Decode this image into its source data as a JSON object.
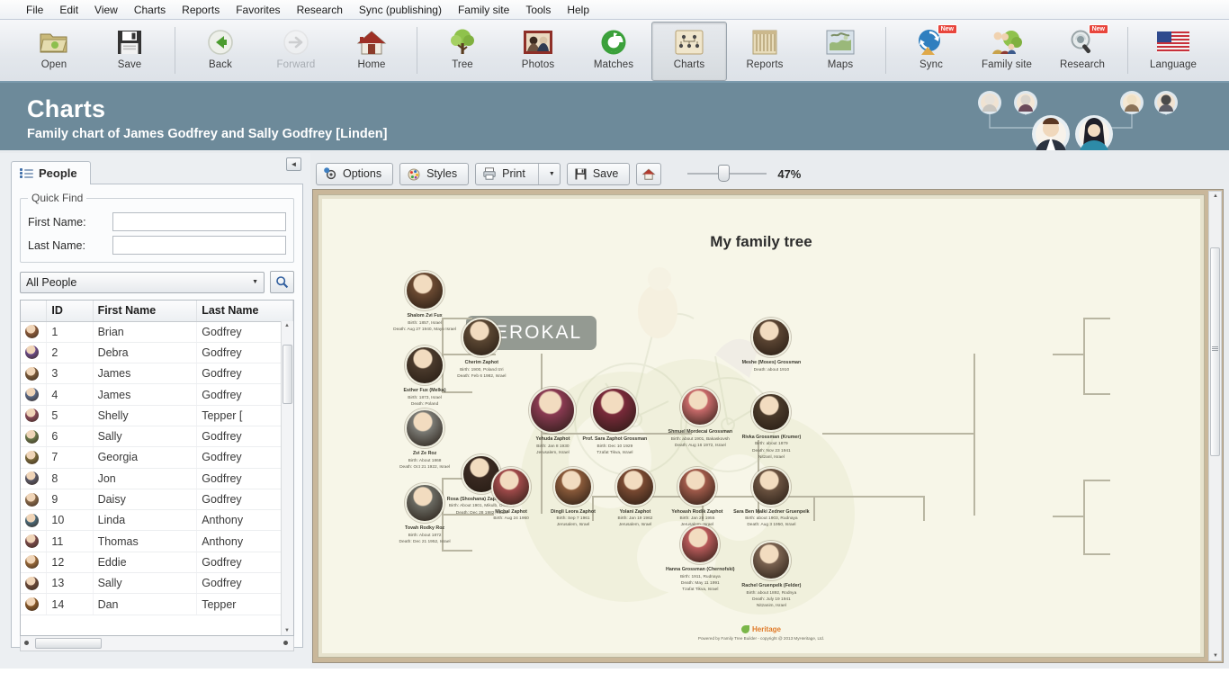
{
  "menu": {
    "items": [
      "File",
      "Edit",
      "View",
      "Charts",
      "Reports",
      "Favorites",
      "Research",
      "Sync (publishing)",
      "Family site",
      "Tools",
      "Help"
    ]
  },
  "toolbar": {
    "groups": [
      {
        "buttons": [
          {
            "label": "Open",
            "icon": "open-folder-icon",
            "state": "normal"
          },
          {
            "label": "Save",
            "icon": "floppy-disk-icon",
            "state": "normal"
          }
        ]
      },
      {
        "buttons": [
          {
            "label": "Back",
            "icon": "back-arrow-icon",
            "state": "normal"
          },
          {
            "label": "Forward",
            "icon": "forward-arrow-icon",
            "state": "disabled"
          },
          {
            "label": "Home",
            "icon": "house-icon",
            "state": "normal"
          }
        ]
      },
      {
        "buttons": [
          {
            "label": "Tree",
            "icon": "tree-icon",
            "state": "normal"
          },
          {
            "label": "Photos",
            "icon": "photos-icon",
            "state": "normal"
          },
          {
            "label": "Matches",
            "icon": "matches-refresh-icon",
            "state": "normal"
          },
          {
            "label": "Charts",
            "icon": "charts-icon",
            "state": "pressed"
          },
          {
            "label": "Reports",
            "icon": "reports-icon",
            "state": "normal"
          },
          {
            "label": "Maps",
            "icon": "maps-globe-icon",
            "state": "normal"
          }
        ]
      },
      {
        "buttons": [
          {
            "label": "Sync",
            "icon": "sync-icon",
            "state": "normal",
            "badge": "New"
          },
          {
            "label": "Family site",
            "icon": "family-site-icon",
            "state": "normal"
          },
          {
            "label": "Research",
            "icon": "research-magnifier-icon",
            "state": "normal",
            "badge": "New"
          }
        ]
      },
      {
        "buttons": [
          {
            "label": "Language",
            "icon": "us-flag-icon",
            "state": "normal"
          }
        ]
      }
    ]
  },
  "header": {
    "title": "Charts",
    "subtitle": "Family chart of James Godfrey and Sally Godfrey [Linden]",
    "accent_color": "#6d8a9a"
  },
  "sidebar": {
    "tab_label": "People",
    "collapse_icon": "collapse-left-icon",
    "quick_find": {
      "legend": "Quick Find",
      "first_name_label": "First Name:",
      "first_name_value": "",
      "first_name_placeholder": "",
      "last_name_label": "Last Name:",
      "last_name_value": "",
      "last_name_placeholder": ""
    },
    "filter": {
      "selected": "All People",
      "options": [
        "All People"
      ],
      "search_icon": "magnifier-icon"
    },
    "table": {
      "columns": [
        "ID",
        "First Name",
        "Last Name"
      ],
      "rows": [
        {
          "id": "1",
          "first": "Brian",
          "last": "Godfrey"
        },
        {
          "id": "2",
          "first": "Debra",
          "last": "Godfrey"
        },
        {
          "id": "3",
          "first": "James",
          "last": "Godfrey"
        },
        {
          "id": "4",
          "first": "James",
          "last": "Godfrey"
        },
        {
          "id": "5",
          "first": "Shelly",
          "last": "Tepper ["
        },
        {
          "id": "6",
          "first": "Sally",
          "last": "Godfrey"
        },
        {
          "id": "7",
          "first": "Georgia",
          "last": "Godfrey"
        },
        {
          "id": "8",
          "first": "Jon",
          "last": "Godfrey"
        },
        {
          "id": "9",
          "first": "Daisy",
          "last": "Godfrey"
        },
        {
          "id": "10",
          "first": "Linda",
          "last": "Anthony"
        },
        {
          "id": "11",
          "first": "Thomas",
          "last": "Anthony"
        },
        {
          "id": "12",
          "first": "Eddie",
          "last": "Godfrey"
        },
        {
          "id": "13",
          "first": "Sally",
          "last": "Godfrey"
        },
        {
          "id": "14",
          "first": "Dan",
          "last": "Tepper"
        }
      ]
    }
  },
  "chart_toolbar": {
    "options_label": "Options",
    "options_icon": "options-gear-icon",
    "styles_label": "Styles",
    "styles_icon": "styles-palette-icon",
    "print_label": "Print",
    "print_icon": "printer-icon",
    "print_caret": "dropdown-caret-icon",
    "save_label": "Save",
    "save_icon": "floppy-disk-icon",
    "home_icon": "home-house-icon",
    "zoom_value": "47%"
  },
  "chart": {
    "title": "My family tree",
    "watermark": "BEROKAL",
    "footer_brand": "Heritage",
    "footer_note": "Powered by Family Tree Builder - copyright @ 2013 MyHeritage, Ltd.",
    "nodes": [
      {
        "slot": "gf1",
        "name": "Shalom Zvi Fux",
        "lines": [
          "Birth: 1857, Israel",
          "Death: Aug 27 1940, Mayo Israel"
        ]
      },
      {
        "slot": "gm1",
        "name": "Esther Fux (Melka)",
        "lines": [
          "Birth: 1873, Israel",
          "Death: Poland"
        ]
      },
      {
        "slot": "f1",
        "name": "Cherim Zaphot",
        "lines": [
          "Birth: 1900, Poland Izri",
          "Death: Feb 6 1982, Israel"
        ]
      },
      {
        "slot": "gf2",
        "name": "Zvi Ze Roz",
        "lines": [
          "Birth: About 1868",
          "Death: Oct 21 1922, Israel"
        ]
      },
      {
        "slot": "gm2",
        "name": "Tovah Rodky Roz",
        "lines": [
          "Birth: About 1872",
          "Death: Dec 21 1952, Israel"
        ]
      },
      {
        "slot": "m1",
        "name": "Rosa (Shoshana) Zaphot (Roz)",
        "lines": [
          "Birth: About 1901, Mikulb, Orlando",
          "Death: Dec 28 1982, Israel"
        ]
      },
      {
        "slot": "dadC",
        "name": "Yehuda Zaphot",
        "lines": [
          "Birth: Jan 8 1930",
          "Jerusalem, Israel"
        ]
      },
      {
        "slot": "momC",
        "name": "Prof. Sara Zaphot Grossman",
        "lines": [
          "Birth: Dec 10 1929",
          "Tzafat Tikva, Israel"
        ]
      },
      {
        "slot": "c1",
        "name": "Michal Zaphot",
        "lines": [
          "Birth: Aug 24 1960"
        ]
      },
      {
        "slot": "c2",
        "name": "Dingli Leora Zaphot",
        "lines": [
          "Birth: Sep 7 1961",
          "Jerusalem, Israel"
        ]
      },
      {
        "slot": "c3",
        "name": "Yolani Zaphot",
        "lines": [
          "Birth: Jan 19 1962",
          "Jerusalem, Israel"
        ]
      },
      {
        "slot": "c4",
        "name": "Yehoash Rodik Zaphot",
        "lines": [
          "Birth: Jan 28 1955",
          "Jerusalem, Israel"
        ]
      },
      {
        "slot": "rGF",
        "name": "Shmuel Mordecai Grossman",
        "lines": [
          "Birth: about 1901, Bakaskovsh",
          "Death: Aug 16 1972, Israel"
        ]
      },
      {
        "slot": "rC1",
        "name": "Meshe (Moses) Grossman",
        "lines": [
          "Death: about 1910"
        ]
      },
      {
        "slot": "rC2",
        "name": "Rivka Grossman (Krumer)",
        "lines": [
          "Birth: about 1879",
          "Death: Nov 23 1941",
          "Nitzanl, Israel"
        ]
      },
      {
        "slot": "rGM",
        "name": "Hanna Grossman (Chernofski)",
        "lines": [
          "Birth: 1911, Rudnaya",
          "Death: May 11 1991",
          "Tzafat Tikva, Israel"
        ]
      },
      {
        "slot": "rC3",
        "name": "Sara Ben Malki Zedner Gruenpelk",
        "lines": [
          "Birth: about 1903, Rudnaya",
          "Death: Aug 3 1950, Israel"
        ]
      },
      {
        "slot": "rC4",
        "name": "Rachel Gruenpelk (Felder)",
        "lines": [
          "Birth: about 1892, Rodnya",
          "Death: July 19 1941",
          "Nitzanim, Israel"
        ]
      }
    ]
  }
}
